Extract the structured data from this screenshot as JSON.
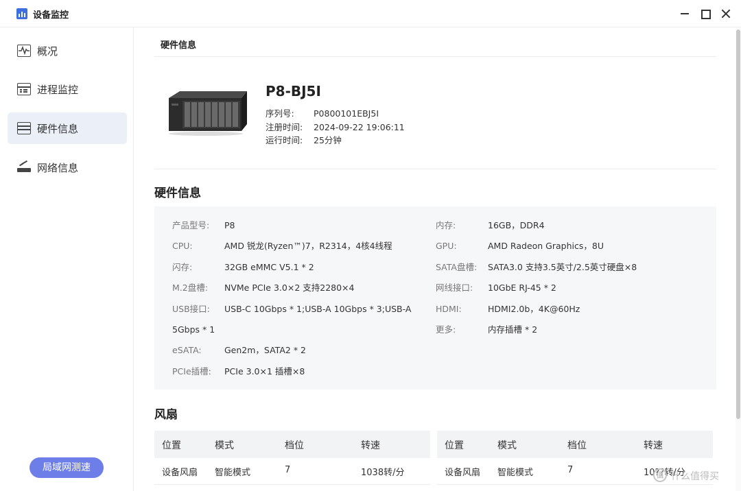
{
  "window": {
    "title": "设备监控"
  },
  "sidebar": {
    "items": [
      {
        "label": "概况",
        "icon": "pulse-monitor-icon",
        "active": false
      },
      {
        "label": "进程监控",
        "icon": "process-list-icon",
        "active": false
      },
      {
        "label": "硬件信息",
        "icon": "hardware-rack-icon",
        "active": true
      },
      {
        "label": "网络信息",
        "icon": "router-icon",
        "active": false
      }
    ],
    "lan_test_button": "局域网测速"
  },
  "main": {
    "header_tab": "硬件信息",
    "device": {
      "name": "P8-BJ5I",
      "image_icon": "nas-device-icon",
      "rows": [
        {
          "key": "序列号:",
          "value": "P0800101EBJ5I"
        },
        {
          "key": "注册时间:",
          "value": "2024-09-22 19:06:11"
        },
        {
          "key": "运行时间:",
          "value": "25分钟"
        }
      ]
    },
    "hardware": {
      "title": "硬件信息",
      "left": [
        {
          "key": "产品型号:",
          "value": "P8"
        },
        {
          "key": "CPU:",
          "value": "AMD 锐龙(Ryzen™)7，R2314，4核4线程"
        },
        {
          "key": "闪存:",
          "value": "32GB eMMC V5.1 * 2"
        },
        {
          "key": "M.2盘槽:",
          "value": "NVMe PCIe 3.0×2 支持2280×4"
        },
        {
          "key": "USB接口:",
          "value": "USB-C 10Gbps * 1;USB-A 10Gbps * 3;USB-A",
          "value_cont": "5Gbps * 1"
        },
        {
          "key": "eSATA:",
          "value": "Gen2m，SATA2 * 2"
        },
        {
          "key": "PCIe插槽:",
          "value": "PCIe 3.0×1 插槽×8"
        }
      ],
      "right": [
        {
          "key": "内存:",
          "value": "16GB，DDR4"
        },
        {
          "key": "GPU:",
          "value": "AMD Radeon Graphics，8U"
        },
        {
          "key": "SATA盘槽:",
          "value": "SATA3.0 支持3.5英寸/2.5英寸硬盘×8"
        },
        {
          "key": "网线接口:",
          "value": "10GbE RJ-45 * 2"
        },
        {
          "key": "HDMI:",
          "value": "HDMI2.0b，4K@60Hz"
        },
        {
          "key": "更多:",
          "value": "内存插槽 * 2"
        }
      ]
    },
    "fan": {
      "title": "风扇",
      "columns": [
        "位置",
        "模式",
        "档位",
        "转速"
      ],
      "tables": [
        {
          "rows": [
            [
              "设备风扇",
              "智能模式",
              "7",
              "1038转/分"
            ]
          ]
        },
        {
          "rows": [
            [
              "设备风扇",
              "智能模式",
              "7",
              "10??转/分"
            ]
          ]
        }
      ]
    }
  },
  "watermark": {
    "logo": "值",
    "text": "什么值得买"
  },
  "colors": {
    "accent": "#6d7ee8",
    "active_nav_bg": "#eaeff8",
    "panel_bg": "#f6f7f9",
    "app_icon": "#3d6fe0"
  }
}
